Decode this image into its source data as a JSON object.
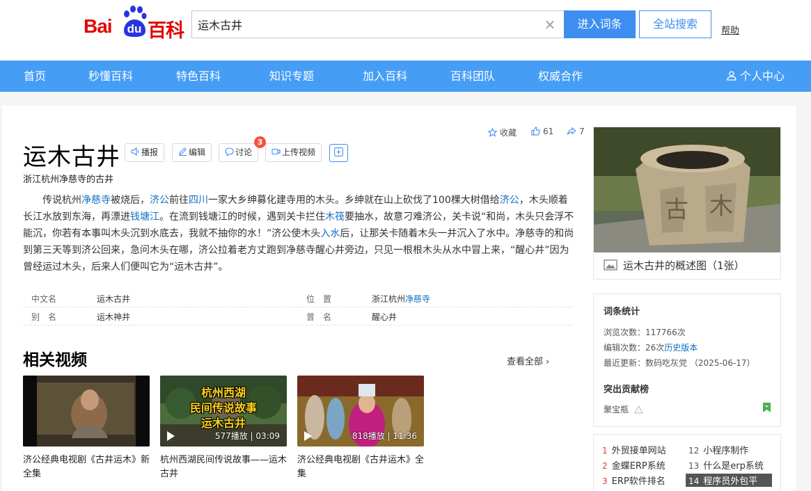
{
  "header": {
    "logo": {
      "bai": "Bai",
      "du": "du",
      "baike": "百科"
    },
    "search_value": "运木古井",
    "enter_button": "进入词条",
    "site_search_button": "全站搜索",
    "help": "帮助"
  },
  "nav": {
    "items": [
      "首页",
      "秒懂百科",
      "特色百科",
      "知识专题",
      "加入百科",
      "百科团队",
      "权威合作"
    ],
    "user_center": "个人中心"
  },
  "entry": {
    "title": "运木古井",
    "subtitle": "浙江杭州净慈寺的古井",
    "tools": {
      "broadcast": "播报",
      "edit": "编辑",
      "discuss": "讨论",
      "discuss_badge": "3",
      "upload_video": "上传视频"
    },
    "stats": {
      "favorite": "收藏",
      "likes": "61",
      "shares": "7"
    },
    "summary": {
      "p1": "传说杭州",
      "l1": "净慈寺",
      "p2": "被烧后，",
      "l2": "济公",
      "p3": "前往",
      "l3": "四川",
      "p4": "一家大乡绅募化建寺用的木头。乡绅就在山上砍伐了100棵大树借给",
      "l4": "济公",
      "p5": "，木头顺着长江水放到东海，再漂进",
      "l5": "钱塘江",
      "p6": "。在流到钱塘江的时候，遇到关卡拦住",
      "l6": "木筏",
      "p7": "要抽水，故意刁难济公，关卡说“和尚，木头只会浮不能沉，你若有本事叫木头沉到水底去，我就不抽你的水！”济公使木头",
      "l7": "入水",
      "p8": "后，让那关卡随着木头一并沉入了水中。净慈寺的和尚到第三天等到济公回来，急问木头在哪，济公拉着老方丈跑到净慈寺醒心井旁边，只见一根根木头从水中冒上来，“醒心井”因为曾经运过木头，后来人们便叫它为“运木古井”。"
    },
    "basic_info": {
      "cn_name_label": "中文名",
      "cn_name_value": "运木古井",
      "location_label": "位　置",
      "location_value_prefix": "浙江杭州",
      "location_value_link": "净慈寺",
      "alias_label": "别　名",
      "alias_value": "运木神井",
      "former_label": "曾　名",
      "former_value": "醒心井"
    }
  },
  "videos": {
    "section_title": "相关视频",
    "see_all": "查看全部",
    "items": [
      {
        "title": "济公经典电视剧《古井运木》新全集",
        "meta": ""
      },
      {
        "title": "杭州西湖民间传说故事——运木古井",
        "meta": "577播放 | 03:09",
        "overlay_lines": [
          "杭州西湖",
          "民间传说故事",
          "运木古井"
        ]
      },
      {
        "title": "济公经典电视剧《古井运木》全集",
        "meta": "818播放 | 11:36"
      }
    ]
  },
  "sidebar": {
    "image_caption": "运木古井的概述图（1张）",
    "stats_title": "词条统计",
    "views": "浏览次数：117766次",
    "edits_prefix": "编辑次数：26次",
    "edits_link": "历史版本",
    "last_update": "最近更新：数码吃灰党 （2025-06-17）",
    "contrib_title": "突出贡献榜",
    "contributor": "聚宝瓶",
    "hot": [
      {
        "n": "1",
        "text": "外贸接单网站"
      },
      {
        "n": "2",
        "text": "金蝶ERP系统"
      },
      {
        "n": "3",
        "text": "ERP软件排名"
      },
      {
        "n": "12",
        "text": "小程序制作"
      },
      {
        "n": "13",
        "text": "什么是erp系统"
      },
      {
        "n": "14",
        "text": "程序员外包平"
      }
    ]
  },
  "colors": {
    "brand_red": "#e10602",
    "brand_blue": "#2932e1",
    "nav_blue": "#459df5",
    "link": "#136ec2",
    "button_blue": "#3d8ef0",
    "badge": "#f5533d"
  }
}
